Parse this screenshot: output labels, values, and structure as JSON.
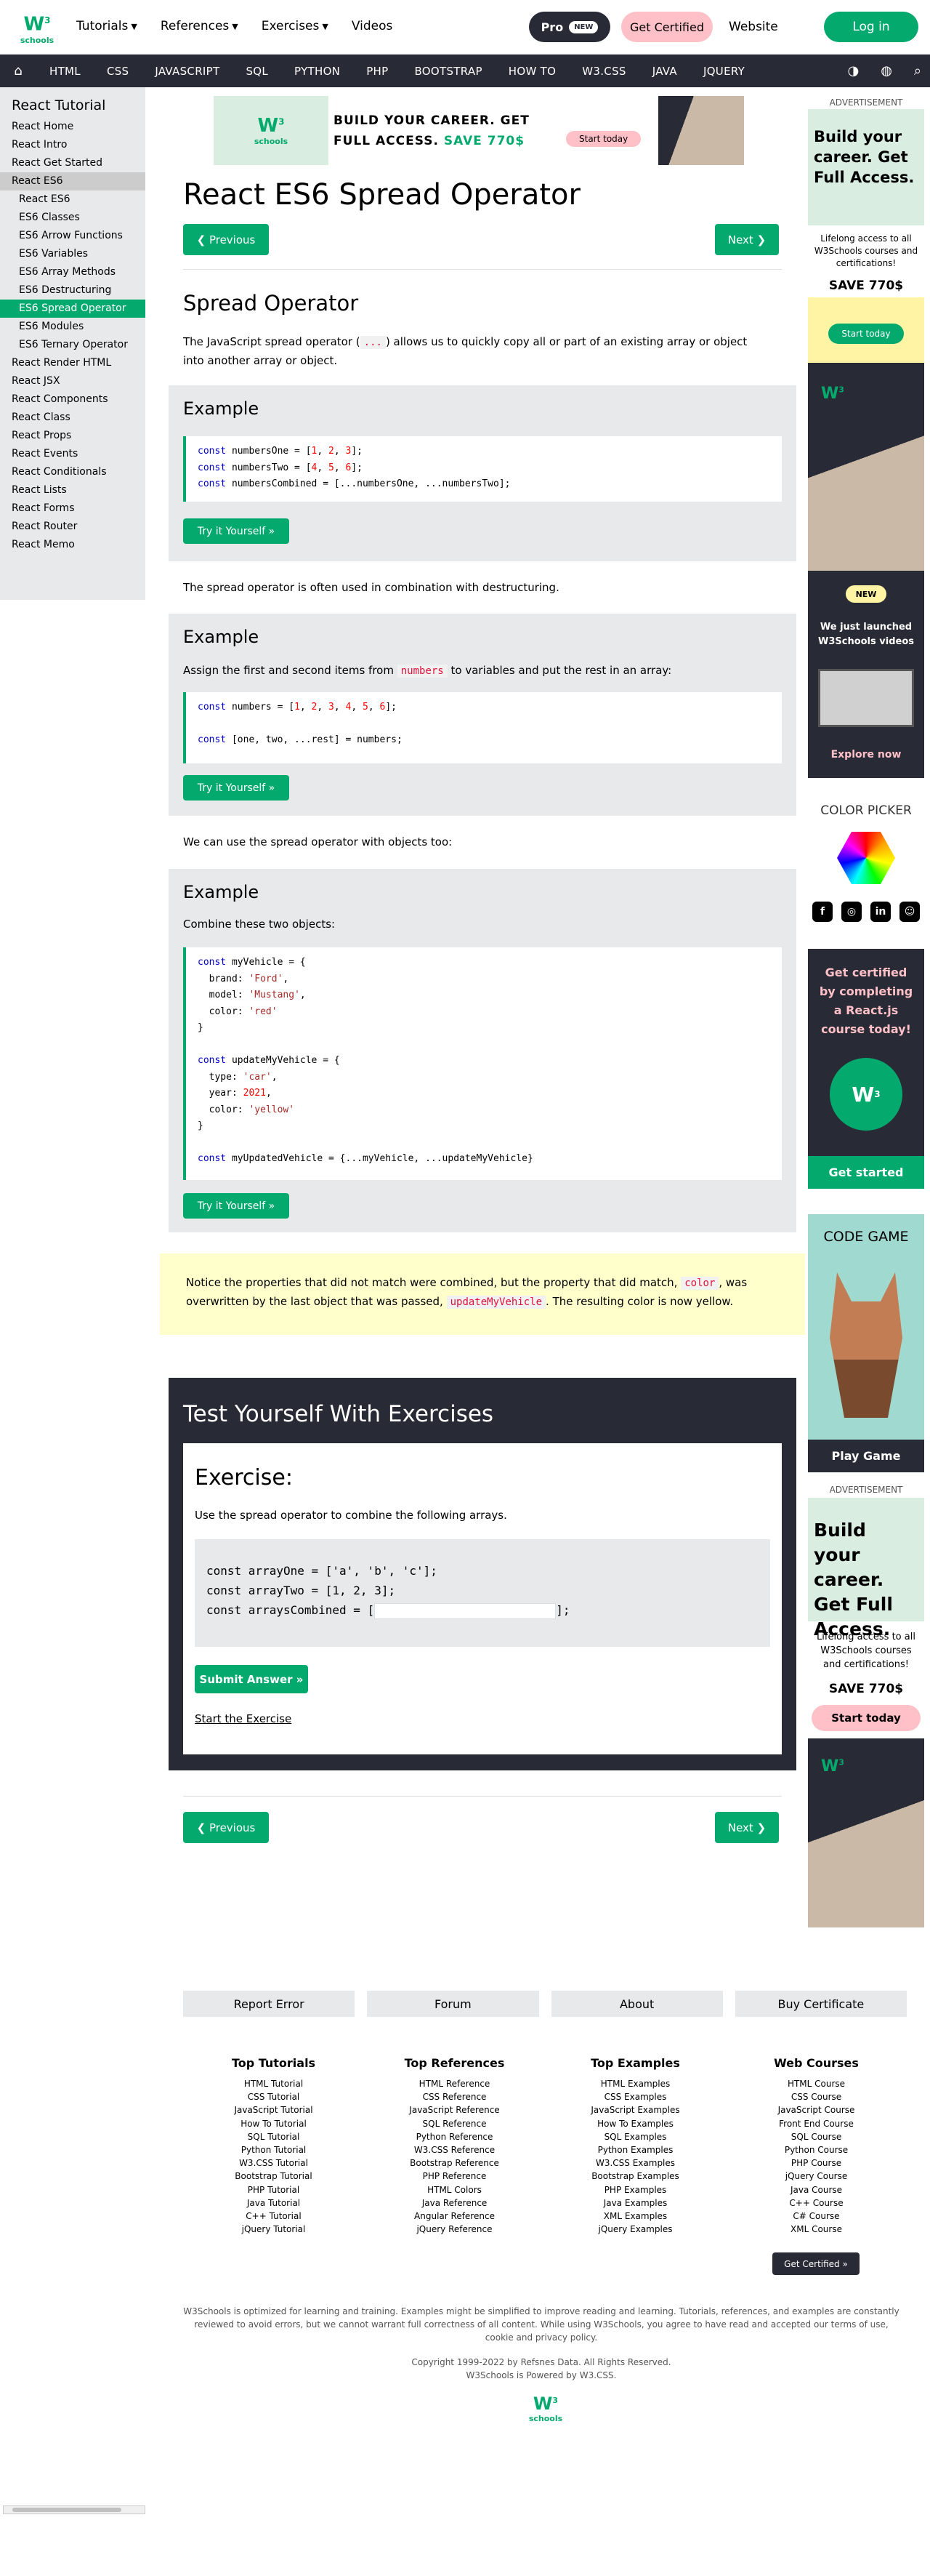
{
  "header": {
    "logo_w": "W",
    "logo_sup": "3",
    "logo_sub": "schools",
    "menu": [
      "Tutorials",
      "References",
      "Exercises",
      "Videos"
    ],
    "pro_label": "Pro",
    "pro_badge": "NEW",
    "get_certified": "Get Certified",
    "website": "Website",
    "login": "Log in"
  },
  "navbar": {
    "items": [
      "HTML",
      "CSS",
      "JAVASCRIPT",
      "SQL",
      "PYTHON",
      "PHP",
      "BOOTSTRAP",
      "HOW TO",
      "W3.CSS",
      "JAVA",
      "JQUERY"
    ]
  },
  "sidebar": {
    "title": "React Tutorial",
    "items": [
      {
        "label": "React Home"
      },
      {
        "label": "React Intro"
      },
      {
        "label": "React Get Started"
      },
      {
        "label": "React ES6"
      },
      {
        "label": "React ES6"
      },
      {
        "label": "ES6 Classes"
      },
      {
        "label": "ES6 Arrow Functions"
      },
      {
        "label": "ES6 Variables"
      },
      {
        "label": "ES6 Array Methods"
      },
      {
        "label": "ES6 Destructuring"
      },
      {
        "label": "ES6 Spread Operator"
      },
      {
        "label": "ES6 Modules"
      },
      {
        "label": "ES6 Ternary Operator"
      },
      {
        "label": "React Render HTML"
      },
      {
        "label": "React JSX"
      },
      {
        "label": "React Components"
      },
      {
        "label": "React Class"
      },
      {
        "label": "React Props"
      },
      {
        "label": "React Events"
      },
      {
        "label": "React Conditionals"
      },
      {
        "label": "React Lists"
      },
      {
        "label": "React Forms"
      },
      {
        "label": "React Router"
      },
      {
        "label": "React Memo"
      }
    ]
  },
  "banner": {
    "line1": "BUILD YOUR CAREER. GET",
    "line2": "FULL ACCESS.",
    "save": "SAVE 770$",
    "start": "Start today"
  },
  "main": {
    "title": "React ES6 Spread Operator",
    "prev": "❮ Previous",
    "next": "Next ❯",
    "section_title": "Spread Operator",
    "intro_a": "The JavaScript spread operator (",
    "intro_code": "...",
    "intro_b": ") allows us to quickly copy all or part of an existing array or object",
    "intro_c": "into another array or object.",
    "example_label": "Example",
    "try_label": "Try it Yourself »",
    "para2": "The spread operator is often used in combination with destructuring.",
    "ex2_desc_a": "Assign the first and second items from ",
    "ex2_desc_code": "numbers",
    "ex2_desc_b": " to variables and put the rest in an array:",
    "para3": "We can use the spread operator with objects too:",
    "ex3_desc": "Combine these two objects:",
    "note_a": "Notice the properties that did not match were combined, but the property that did match, ",
    "note_code1": "color",
    "note_b": ", was",
    "note_c": "overwritten by the last object that was passed, ",
    "note_code2": "updateMyVehicle",
    "note_d": ". The resulting color is now yellow."
  },
  "exercise": {
    "heading": "Test Yourself With Exercises",
    "sub": "Exercise:",
    "question": "Use the spread operator to combine the following arrays.",
    "line1": "const arrayOne = ['a', 'b', 'c'];",
    "line2": "const arrayTwo = [1, 2, 3];",
    "line3a": "const arraysCombined = [",
    "line3b": "];",
    "submit": "Submit Answer »",
    "start": "Start the Exercise"
  },
  "right": {
    "ad_label": "ADVERTISEMENT",
    "ad1_head": "Build your career. Get Full Access.",
    "ad1_body": "Lifelong access to all W3Schools courses and certifications!",
    "ad1_save": "SAVE 770$",
    "ad1_start": "Start today",
    "ad2_new": "NEW",
    "ad2_msg": "We just launched W3Schools videos",
    "ad2_explore": "Explore now",
    "color_picker": "COLOR PICKER",
    "ad3_msg": "Get certified by completing a React.js course today!",
    "ad3_btn": "Get started",
    "ad4_title": "CODE GAME",
    "ad4_btn": "Play Game",
    "ad5_head": "Build your career. Get Full Access.",
    "ad5_body": "Lifelong access to all W3Schools courses and certifications!",
    "ad5_save": "SAVE 770$",
    "ad5_start": "Start today"
  },
  "footer": {
    "buttons": [
      "Report Error",
      "Forum",
      "About",
      "Buy Certificate"
    ],
    "cols": [
      {
        "title": "Top Tutorials",
        "links": [
          "HTML Tutorial",
          "CSS Tutorial",
          "JavaScript Tutorial",
          "How To Tutorial",
          "SQL Tutorial",
          "Python Tutorial",
          "W3.CSS Tutorial",
          "Bootstrap Tutorial",
          "PHP Tutorial",
          "Java Tutorial",
          "C++ Tutorial",
          "jQuery Tutorial"
        ]
      },
      {
        "title": "Top References",
        "links": [
          "HTML Reference",
          "CSS Reference",
          "JavaScript Reference",
          "SQL Reference",
          "Python Reference",
          "W3.CSS Reference",
          "Bootstrap Reference",
          "PHP Reference",
          "HTML Colors",
          "Java Reference",
          "Angular Reference",
          "jQuery Reference"
        ]
      },
      {
        "title": "Top Examples",
        "links": [
          "HTML Examples",
          "CSS Examples",
          "JavaScript Examples",
          "How To Examples",
          "SQL Examples",
          "Python Examples",
          "W3.CSS Examples",
          "Bootstrap Examples",
          "PHP Examples",
          "Java Examples",
          "XML Examples",
          "jQuery Examples"
        ]
      },
      {
        "title": "Web Courses",
        "links": [
          "HTML Course",
          "CSS Course",
          "JavaScript Course",
          "Front End Course",
          "SQL Course",
          "Python Course",
          "PHP Course",
          "jQuery Course",
          "Java Course",
          "C++ Course",
          "C# Course",
          "XML Course"
        ]
      }
    ],
    "cert_btn": "Get Certified »",
    "disclaimer1": "W3Schools is optimized for learning and training. Examples might be simplified to improve reading and learning. Tutorials, references, and examples are constantly",
    "disclaimer2": "reviewed to avoid errors, but we cannot warrant full correctness of all content. While using W3Schools, you agree to have read and accepted our terms of use,",
    "disclaimer3": "cookie and privacy policy.",
    "copyright": "Copyright 1999-2022 by Refsnes Data. All Rights Reserved.",
    "powered": "W3Schools is Powered by W3.CSS."
  },
  "colors": {
    "accent": "#04aa6d",
    "dark": "#282a35",
    "pink": "#ffc0c7",
    "note": "#ffffcc"
  }
}
